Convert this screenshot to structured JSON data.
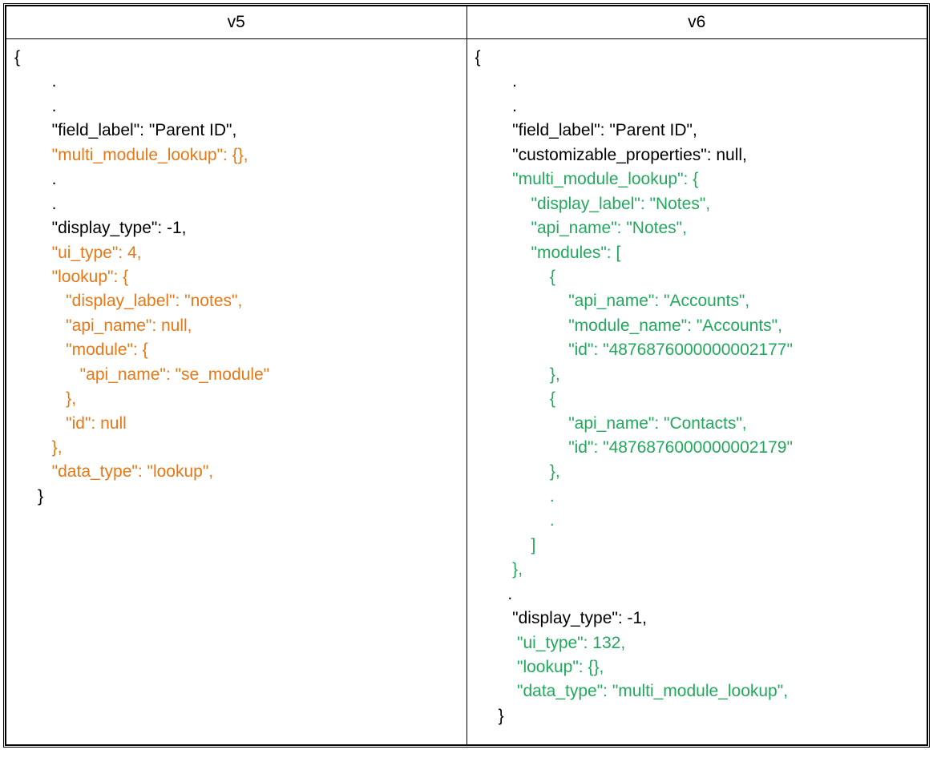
{
  "headers": {
    "left": "v5",
    "right": "v6"
  },
  "colors": {
    "default": "#000000",
    "removed": "#e67817",
    "added": "#22a95d"
  },
  "left": {
    "l1": "{",
    "l2": "        .",
    "l3": "        .",
    "l4": "        \"field_label\": \"Parent ID\",",
    "l5": "        \"multi_module_lookup\": {},",
    "l6": "        .",
    "l7": "        .",
    "l8": "        \"display_type\": -1,",
    "l9": "        \"ui_type\": 4,",
    "l10": "        \"lookup\": {",
    "l11": "           \"display_label\": \"notes\",",
    "l12": "           \"api_name\": null,",
    "l13": "           \"module\": {",
    "l14": "              \"api_name\": \"se_module\"",
    "l15": "           },",
    "l16": "           \"id\": null",
    "l17": "        },",
    "l18": "        \"data_type\": \"lookup\",",
    "l19": "     }"
  },
  "right": {
    "l1": "{",
    "l2": "        .",
    "l3": "        .",
    "l4": "        \"field_label\": \"Parent ID\",",
    "l5": "        \"customizable_properties\": null,",
    "l6": "        \"multi_module_lookup\": {",
    "l7": "            \"display_label\": \"Notes\",",
    "l8": "            \"api_name\": \"Notes\",",
    "l9": "            \"modules\": [",
    "l10": "                {",
    "l11": "                    \"api_name\": \"Accounts\",",
    "l12": "                    \"module_name\": \"Accounts\",",
    "l13": "                    \"id\": \"4876876000000002177\"",
    "l14": "                },",
    "l15": "                {",
    "l16": "                    \"api_name\": \"Contacts\",",
    "l17": "                    \"id\": \"4876876000000002179\"",
    "l18": "                },",
    "l19": "                .",
    "l20": "                .",
    "l21": "            ]",
    "l22": "        },",
    "l23": "       .",
    "l24": "        \"display_type\": -1,",
    "l25": "         \"ui_type\": 132,",
    "l26": "         \"lookup\": {},",
    "l27": "         \"data_type\": \"multi_module_lookup\",",
    "l28": "     }"
  }
}
